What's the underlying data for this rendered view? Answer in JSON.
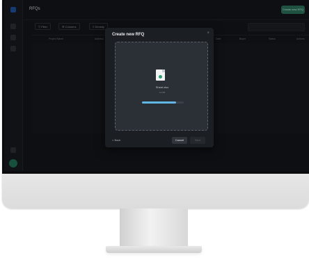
{
  "app": {
    "page_title": "RFQs",
    "new_button_label": "Create new RFQ"
  },
  "toolbar": {
    "filter_label": "Filter",
    "columns_label": "Columns",
    "density_label": "Density"
  },
  "table": {
    "headers": [
      "Project Name",
      "Address",
      "Date",
      "Buyer",
      "Status",
      "Actions"
    ]
  },
  "dialog": {
    "title": "Create new RFQ",
    "close_glyph": "×",
    "file": {
      "name": "Sheet.xlsx",
      "size": "12 KB",
      "upload_progress": 0.82
    },
    "back_label": "< Back",
    "cancel_label": "Cancel",
    "next_label": "Next"
  }
}
